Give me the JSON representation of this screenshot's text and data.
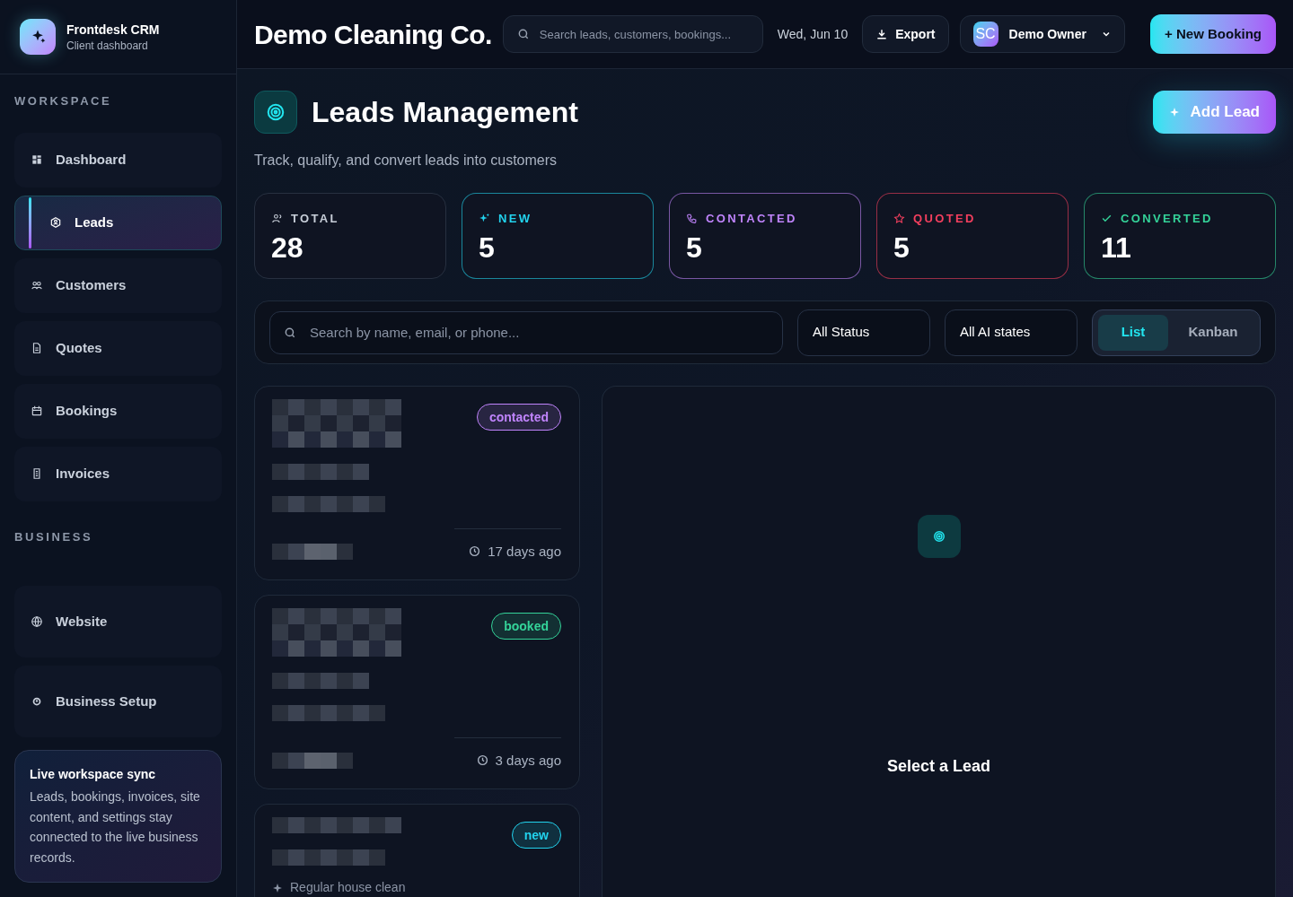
{
  "brand": {
    "name": "Frontdesk CRM",
    "subtitle": "Client dashboard"
  },
  "sidebar": {
    "sections": [
      {
        "title": "WORKSPACE",
        "items": [
          {
            "label": "Dashboard",
            "selected": false
          },
          {
            "label": "Leads",
            "selected": true
          },
          {
            "label": "Customers",
            "selected": false
          },
          {
            "label": "Quotes",
            "selected": false
          },
          {
            "label": "Bookings",
            "selected": false
          },
          {
            "label": "Invoices",
            "selected": false
          }
        ]
      },
      {
        "title": "BUSINESS",
        "items": [
          {
            "label": "Website",
            "selected": false
          },
          {
            "label": "Business Setup",
            "selected": false
          }
        ]
      }
    ],
    "sync_card": {
      "title": "Live workspace sync",
      "text": "Leads, bookings, invoices, site content, and settings stay connected to the live business records."
    }
  },
  "topbar": {
    "title": "Demo Cleaning Co.",
    "search": {
      "placeholder": "Search leads, customers, bookings..."
    },
    "date": "Wed, Jun 10",
    "export": "Export",
    "user": {
      "initials": "SC",
      "name": "Demo Owner"
    },
    "new_booking": "+ New Booking"
  },
  "page": {
    "title": "Leads Management",
    "subtitle": "Track, qualify, and convert leads into customers",
    "add_button": "Add Lead"
  },
  "stats": [
    {
      "label": "TOTAL",
      "value": "28",
      "kind": "total",
      "color": "#c7ced8"
    },
    {
      "label": "NEW",
      "value": "5",
      "kind": "new",
      "color": "#22d3ee"
    },
    {
      "label": "CONTACTED",
      "value": "5",
      "kind": "contacted",
      "color": "#c084fc"
    },
    {
      "label": "QUOTED",
      "value": "5",
      "kind": "quoted",
      "color": "#f43f5e"
    },
    {
      "label": "CONVERTED",
      "value": "11",
      "kind": "converted",
      "color": "#34d399"
    }
  ],
  "filters": {
    "search": {
      "placeholder": "Search by name, email, or phone..."
    },
    "status": "All Status",
    "ai_state": "All AI states",
    "views": [
      {
        "label": "List",
        "selected": true
      },
      {
        "label": "Kanban",
        "selected": false
      }
    ]
  },
  "leads": [
    {
      "status": "contacted",
      "color": "#c084fc",
      "age": "17 days ago"
    },
    {
      "status": "booked",
      "color": "#34d399",
      "age": "3 days ago"
    },
    {
      "status": "new",
      "color": "#22d3ee",
      "service": "Regular house clean"
    }
  ],
  "detail": {
    "empty_title": "Select a Lead"
  }
}
